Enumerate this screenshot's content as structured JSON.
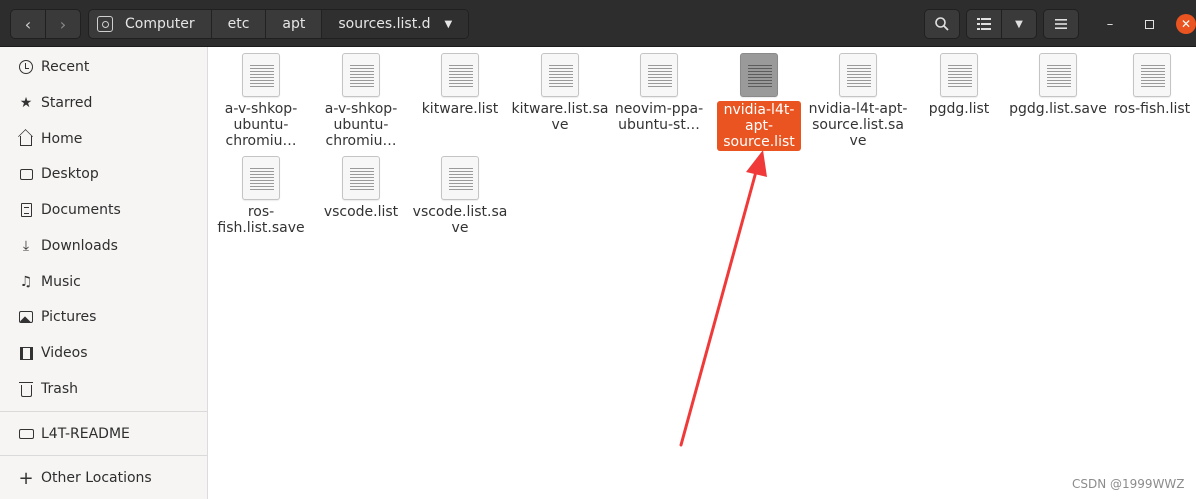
{
  "pathbar": {
    "crumbs": [
      "Computer",
      "etc",
      "apt",
      "sources.list.d"
    ]
  },
  "sidebar": {
    "items": [
      {
        "label": "Recent",
        "icon": "clock-icon"
      },
      {
        "label": "Starred",
        "icon": "star-icon"
      },
      {
        "label": "Home",
        "icon": "home-icon"
      },
      {
        "label": "Desktop",
        "icon": "desktop-icon"
      },
      {
        "label": "Documents",
        "icon": "document-icon"
      },
      {
        "label": "Downloads",
        "icon": "download-icon"
      },
      {
        "label": "Music",
        "icon": "music-icon"
      },
      {
        "label": "Pictures",
        "icon": "picture-icon"
      },
      {
        "label": "Videos",
        "icon": "video-icon"
      },
      {
        "label": "Trash",
        "icon": "trash-icon"
      }
    ],
    "devices": [
      {
        "label": "L4T-README",
        "icon": "drive-icon"
      }
    ],
    "other": {
      "label": "Other Locations",
      "icon": "plus-icon"
    }
  },
  "files": [
    {
      "name": "a-v-shkop-ubuntu-chromiu…",
      "selected": false
    },
    {
      "name": "a-v-shkop-ubuntu-chromiu…",
      "selected": false
    },
    {
      "name": "kitware.list",
      "selected": false
    },
    {
      "name": "kitware.list.save",
      "selected": false
    },
    {
      "name": "neovim-ppa-ubuntu-st…",
      "selected": false
    },
    {
      "name": "nvidia-l4t-apt-source.list",
      "selected": true
    },
    {
      "name": "nvidia-l4t-apt-source.list.save",
      "selected": false
    },
    {
      "name": "pgdg.list",
      "selected": false
    },
    {
      "name": "pgdg.list.save",
      "selected": false
    },
    {
      "name": "ros-fish.list",
      "selected": false
    },
    {
      "name": "ros-fish.list.save",
      "selected": false
    },
    {
      "name": "vscode.list",
      "selected": false
    },
    {
      "name": "vscode.list.save",
      "selected": false
    }
  ],
  "colors": {
    "accent": "#e95420",
    "annotation": "#f03a3a"
  },
  "watermark": "CSDN @1999WWZ"
}
